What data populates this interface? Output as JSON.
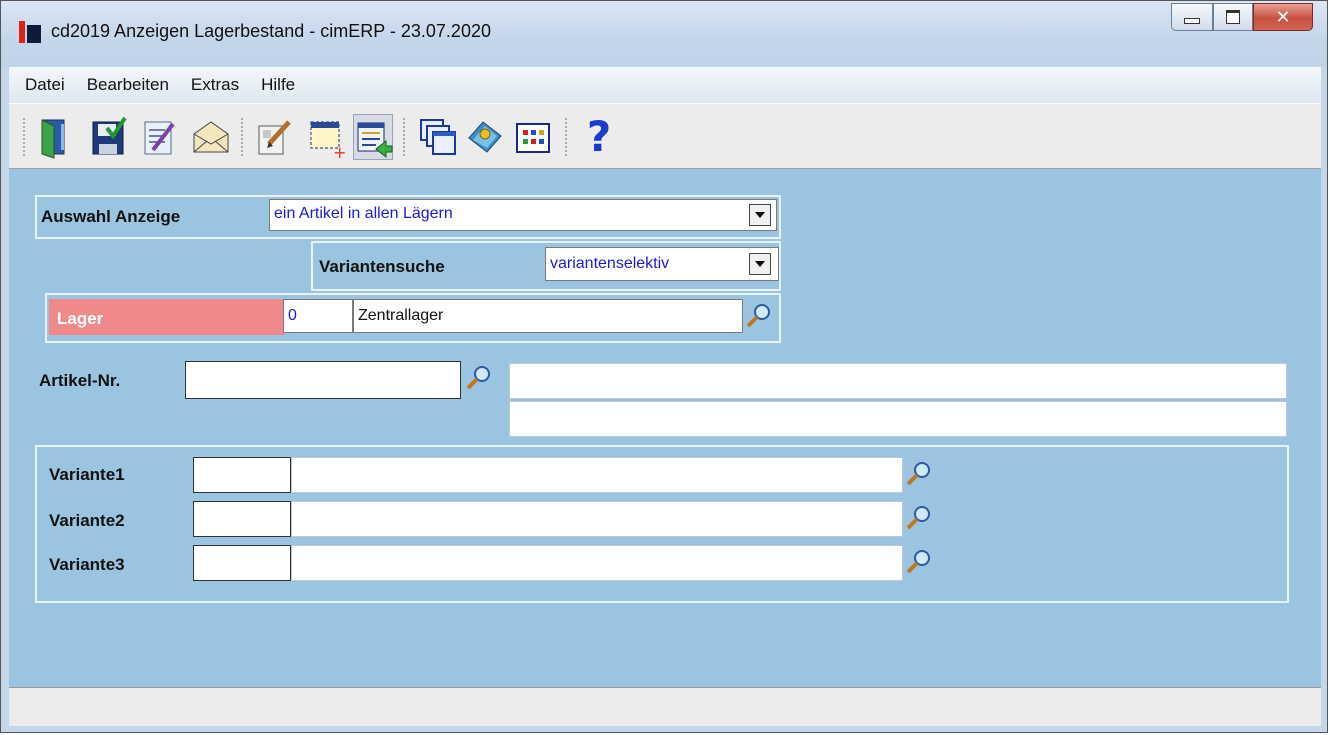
{
  "window": {
    "title": "cd2019 Anzeigen Lagerbestand - cimERP - 23.07.2020",
    "buttons": [
      "minimize",
      "maximize",
      "close"
    ]
  },
  "menu": [
    "Datei",
    "Bearbeiten",
    "Extras",
    "Hilfe"
  ],
  "toolbar": {
    "icons": [
      "exit-door-icon",
      "save-icon",
      "checklist-edit-icon",
      "mail-envelope-icon",
      "edit-pen-icon",
      "new-record-icon",
      "list-transfer-icon",
      "windows-stack-icon",
      "book-icon",
      "grid-table-icon",
      "help-icon"
    ],
    "help_glyph": "?"
  },
  "form": {
    "auswahl_label": "Auswahl Anzeige",
    "auswahl_value": "ein Artikel in allen Lägern",
    "variantensuche_label": "Variantensuche",
    "variantensuche_value": "variantenselektiv",
    "lager_label": "Lager",
    "lager_code": "0",
    "lager_name": "Zentrallager",
    "artikel_label": "Artikel-Nr.",
    "artikel_value": "",
    "artikel_desc1": "",
    "artikel_desc2": "",
    "varianten": [
      {
        "label": "Variante1",
        "code": "",
        "desc": ""
      },
      {
        "label": "Variante2",
        "code": "",
        "desc": ""
      },
      {
        "label": "Variante3",
        "code": "",
        "desc": ""
      }
    ]
  },
  "colors": {
    "form_background": "#9bc4e1",
    "lager_label_background": "#f08a8a",
    "dropdown_text": "#1a1ad0"
  }
}
